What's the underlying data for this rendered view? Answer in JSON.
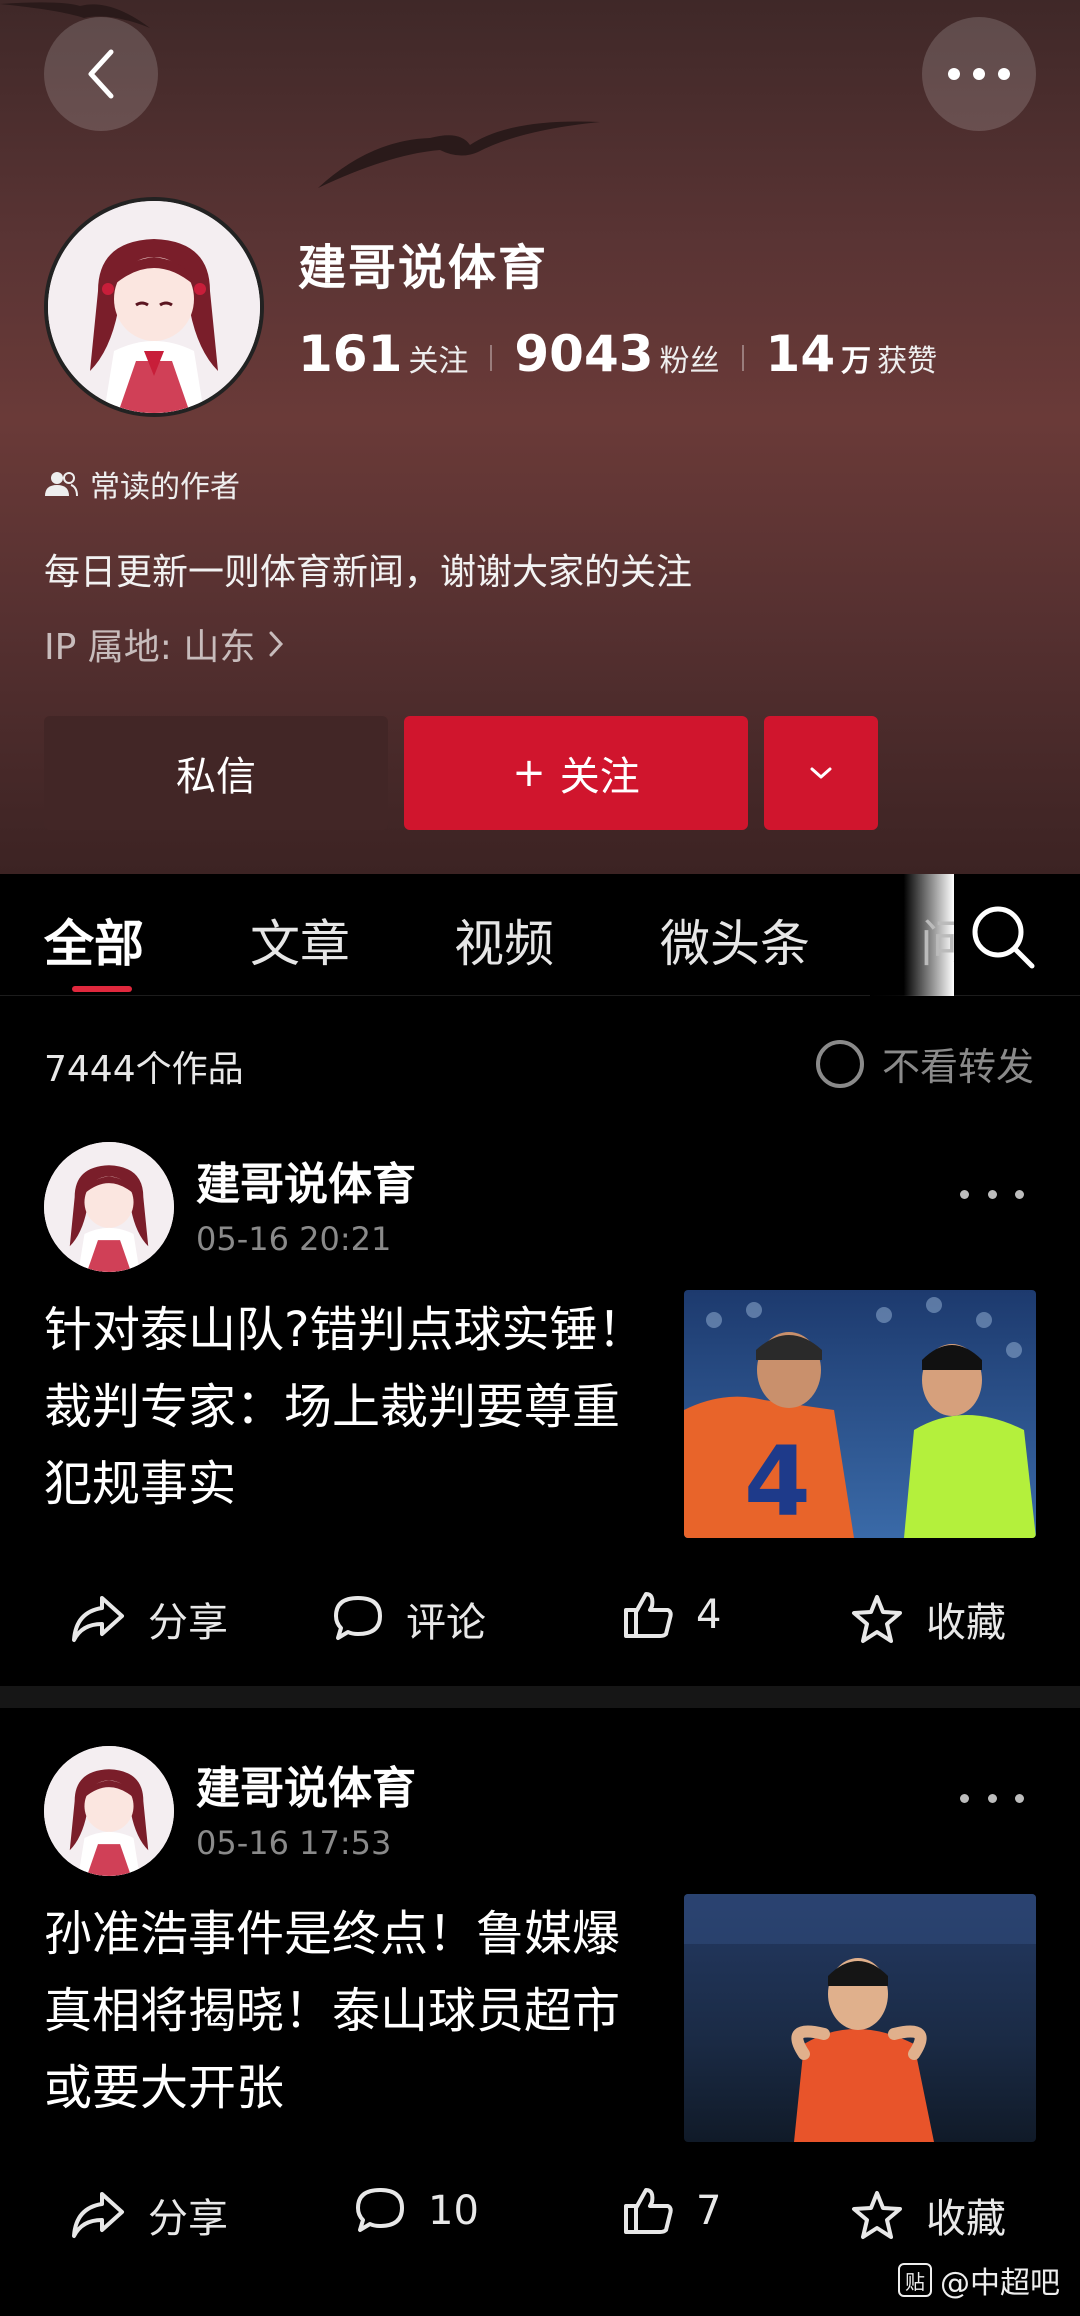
{
  "profile": {
    "name": "建哥说体育",
    "stats": [
      {
        "num": "161",
        "label": "关注"
      },
      {
        "num": "9043",
        "label": "粉丝"
      },
      {
        "num": "14",
        "unit": "万",
        "label": "获赞"
      }
    ],
    "reader_badge": "常读的作者",
    "bio": "每日更新一则体育新闻，谢谢大家的关注",
    "ip": "IP 属地: 山东"
  },
  "buttons": {
    "message": "私信",
    "follow_plus": "+",
    "follow": "关注"
  },
  "tabs": [
    {
      "label": "全部",
      "active": true
    },
    {
      "label": "文章"
    },
    {
      "label": "视频"
    },
    {
      "label": "微头条"
    },
    {
      "label": "问"
    }
  ],
  "feed": {
    "count": "7444个作品",
    "no_repost": "不看转发"
  },
  "posts": [
    {
      "author": "建哥说体育",
      "time": "05-16 20:21",
      "title": "针对泰山队?错判点球实锤！裁判专家：场上裁判要尊重犯规事实",
      "share": "分享",
      "comment": "评论",
      "likes": "4",
      "favorite": "收藏"
    },
    {
      "author": "建哥说体育",
      "time": "05-16 17:53",
      "title": "孙准浩事件是终点！鲁媒爆真相将揭晓！泰山球员超市或要大开张",
      "share": "分享",
      "comment": "10",
      "likes": "7",
      "favorite": "收藏"
    }
  ],
  "watermark": {
    "box": "贴",
    "text": "@中超吧"
  },
  "colors": {
    "accent": "#d0152d",
    "header_bg": "#5a3434"
  }
}
